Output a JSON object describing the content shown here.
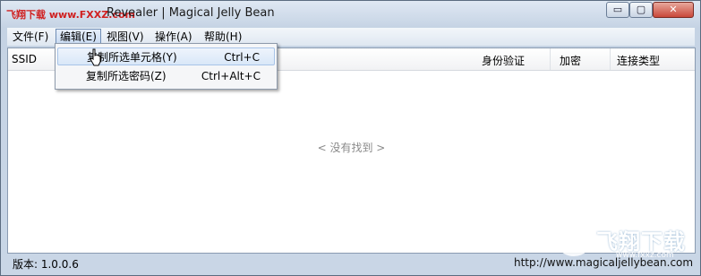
{
  "window": {
    "title": "Revealer | Magical Jelly Bean",
    "watermark": "飞翔下载 www.FXXZ.com",
    "controls": {
      "minimize": "▭",
      "maximize": "▢",
      "close": "✕"
    }
  },
  "menu": {
    "items": [
      {
        "label": "文件(F)",
        "state": "normal"
      },
      {
        "label": "编辑(E)",
        "state": "active"
      },
      {
        "label": "视图(V)",
        "state": "normal"
      },
      {
        "label": "操作(A)",
        "state": "normal"
      },
      {
        "label": "帮助(H)",
        "state": "normal"
      }
    ]
  },
  "dropdown": {
    "items": [
      {
        "label": "复制所选单元格(Y)",
        "shortcut": "Ctrl+C",
        "highlighted": true
      },
      {
        "label": "复制所选密码(Z)",
        "shortcut": "Ctrl+Alt+C",
        "highlighted": false
      }
    ]
  },
  "table": {
    "columns": [
      "SSID",
      "身份验证",
      "加密",
      "连接类型"
    ],
    "empty_text": "< 没有找到 >"
  },
  "status": {
    "version": "版本: 1.0.0.6",
    "link": "http://www.magicaljellybean.com"
  },
  "watermark_logo": {
    "text": "飞翔下载",
    "sub": "www.fxxz.com"
  },
  "colors": {
    "accent": "#6f8db5",
    "watermark_red": "#d02020"
  }
}
